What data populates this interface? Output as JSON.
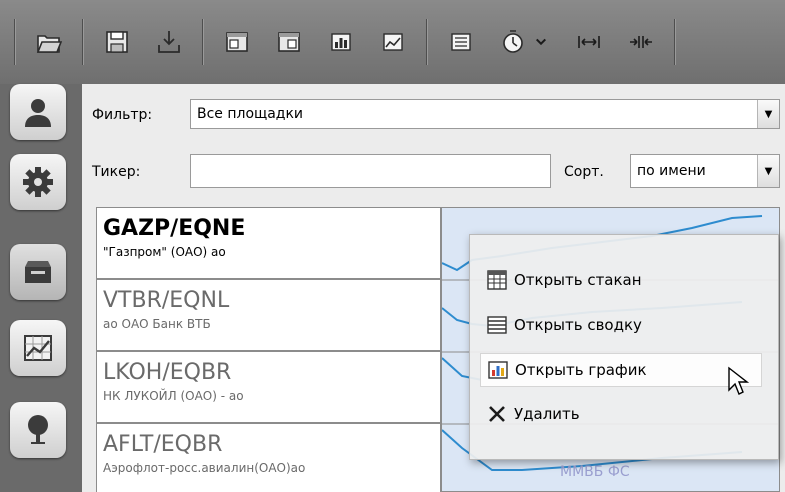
{
  "toolbar": {
    "icons": [
      "open-folder-icon",
      "save-icon",
      "download-icon",
      "window-left-icon",
      "window-right-icon",
      "bar-chart-icon",
      "line-chart-icon",
      "table-icon",
      "timer-icon",
      "chevron-down-icon",
      "expand-horizontal-icon",
      "collapse-horizontal-icon"
    ]
  },
  "rail": {
    "icons": [
      "user-icon",
      "gear-icon",
      "inbox-icon",
      "chart-icon",
      "tree-icon"
    ]
  },
  "filter": {
    "label": "Фильтр:",
    "value": "Все площадки"
  },
  "ticker": {
    "label": "Тикер:",
    "value": "",
    "sort_label": "Сорт.",
    "sort_value": "по имени"
  },
  "list": [
    {
      "code": "GAZP/EQNE",
      "name": "\"Газпром\" (ОАО) ао",
      "active": true
    },
    {
      "code": "VTBR/EQNL",
      "name": "ао ОАО Банк ВТБ",
      "active": false
    },
    {
      "code": "LKOH/EQBR",
      "name": "НК ЛУКОЙЛ (ОАО) - ао",
      "active": false
    },
    {
      "code": "AFLT/EQBR",
      "name": "Аэрофлот-росс.авиалин(ОАО)ао",
      "active": false
    }
  ],
  "chart_watermark": "ММВБ ФС",
  "menu": {
    "items": [
      {
        "label": "Открыть стакан",
        "icon": "order-book-icon"
      },
      {
        "label": "Открыть сводку",
        "icon": "summary-icon"
      },
      {
        "label": "Открыть график",
        "icon": "chart-icon"
      },
      {
        "label": "Удалить",
        "icon": "delete-x-icon"
      }
    ]
  },
  "colors": {
    "toolbar_bg": "#7a7a7a",
    "panel_bg": "#ececec",
    "chart_bg": "#dbe6f5",
    "chart_line": "#2e8ccf"
  }
}
